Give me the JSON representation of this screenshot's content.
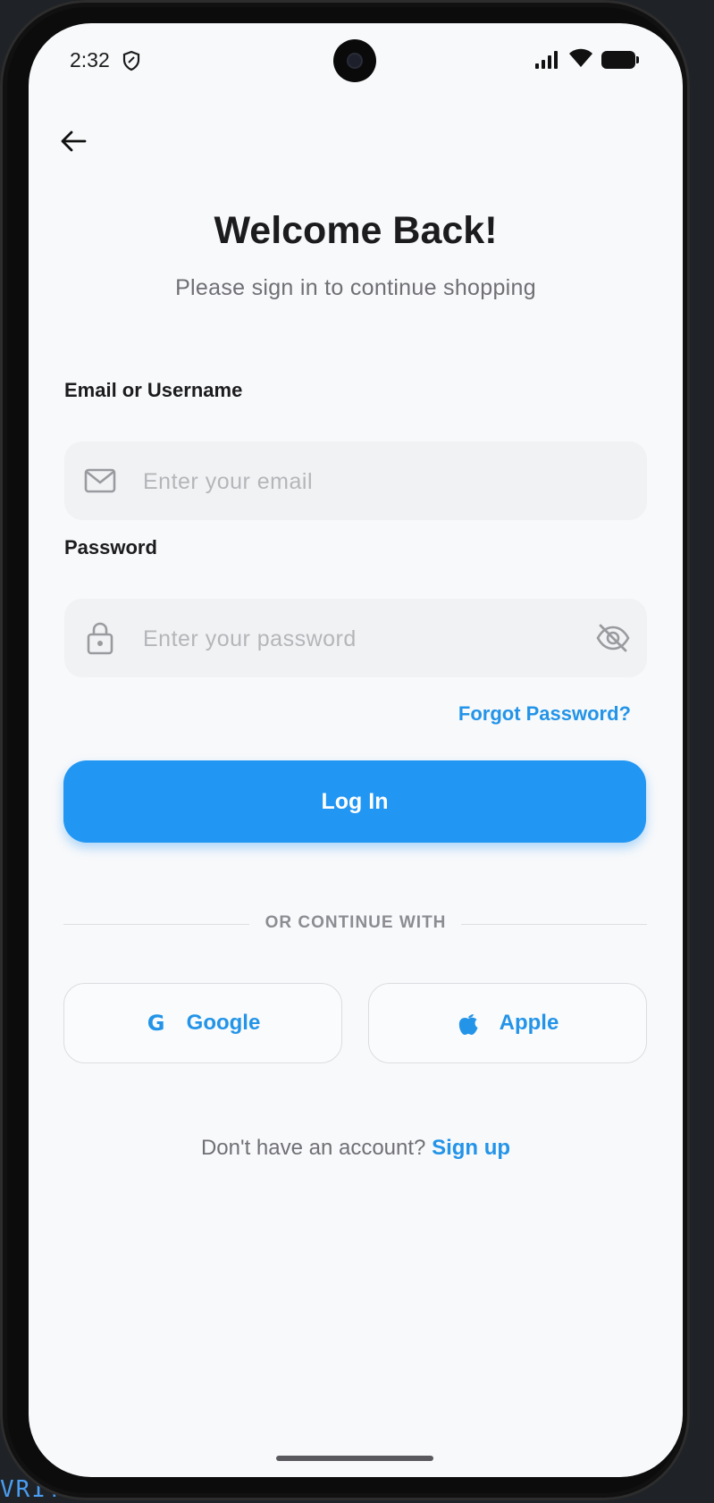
{
  "backdrop": {
    "code_text": "VRITE"
  },
  "status_bar": {
    "time": "2:32",
    "icons": [
      "shield-icon",
      "signal-icon",
      "wifi-icon",
      "battery-icon"
    ]
  },
  "nav": {
    "back_icon": "arrow-left-icon"
  },
  "header": {
    "title": "Welcome Back!",
    "subtitle": "Please sign in to continue shopping"
  },
  "form": {
    "email": {
      "label": "Email or Username",
      "placeholder": "Enter your email",
      "value": "",
      "icon": "mail-icon"
    },
    "password": {
      "label": "Password",
      "placeholder": "Enter your password",
      "value": "",
      "icon": "lock-icon",
      "toggle_icon": "eye-off-icon"
    },
    "forgot_label": "Forgot Password?",
    "login_label": "Log In"
  },
  "social": {
    "divider_text": "OR CONTINUE WITH",
    "google": {
      "label": "Google",
      "glyph": "G"
    },
    "apple": {
      "label": "Apple",
      "icon": "apple-icon"
    }
  },
  "footer": {
    "prompt": "Don't have an account?",
    "signup_label": "Sign up"
  },
  "colors": {
    "accent": "#2196f3",
    "link": "#2394e8",
    "background": "#f8f9fb",
    "field_bg": "#f1f2f4"
  }
}
